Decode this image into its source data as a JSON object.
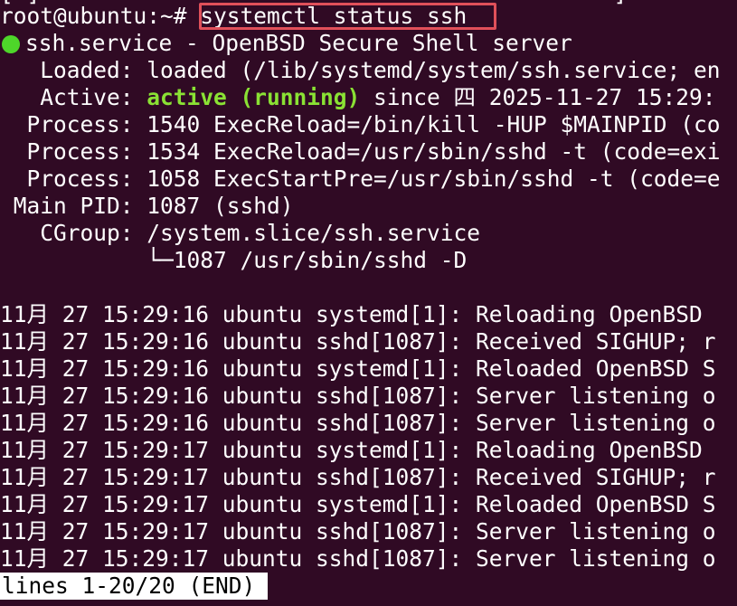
{
  "prompt": {
    "user_host": "root@ubuntu:~# ",
    "command": "systemctl status ssh",
    "prev_line": "[ ]                                           ]"
  },
  "service": {
    "unit": "ssh.service - OpenBSD Secure Shell server",
    "status_dot_color": "#4ed62a",
    "loaded_label": "   Loaded: ",
    "loaded_value": "loaded (/lib/systemd/system/ssh.service; en",
    "active_label": "   Active: ",
    "active_state": "active (running)",
    "active_since": " since 四 2025-11-27 15:29:",
    "processes": [
      "  Process: 1540 ExecReload=/bin/kill -HUP $MAINPID (co",
      "  Process: 1534 ExecReload=/usr/sbin/sshd -t (code=exi",
      "  Process: 1058 ExecStartPre=/usr/sbin/sshd -t (code=e"
    ],
    "main_pid": " Main PID: 1087 (sshd)",
    "cgroup": "   CGroup: /system.slice/ssh.service",
    "cgroup_child": "           └─1087 /usr/sbin/sshd -D"
  },
  "log_lines": [
    "11月 27 15:29:16 ubuntu systemd[1]: Reloading OpenBSD",
    "11月 27 15:29:16 ubuntu sshd[1087]: Received SIGHUP; r",
    "11月 27 15:29:16 ubuntu systemd[1]: Reloaded OpenBSD S",
    "11月 27 15:29:16 ubuntu sshd[1087]: Server listening o",
    "11月 27 15:29:16 ubuntu sshd[1087]: Server listening o",
    "11月 27 15:29:17 ubuntu systemd[1]: Reloading OpenBSD",
    "11月 27 15:29:17 ubuntu sshd[1087]: Received SIGHUP; r",
    "11月 27 15:29:17 ubuntu systemd[1]: Reloaded OpenBSD S",
    "11月 27 15:29:17 ubuntu sshd[1087]: Server listening o",
    "11月 27 15:29:17 ubuntu sshd[1087]: Server listening o"
  ],
  "pager_status": "lines 1-20/20 (END)",
  "colors": {
    "background": "#300a24",
    "foreground": "#ffffff",
    "active_green": "#8ae234",
    "highlight_box": "#e0505a"
  }
}
